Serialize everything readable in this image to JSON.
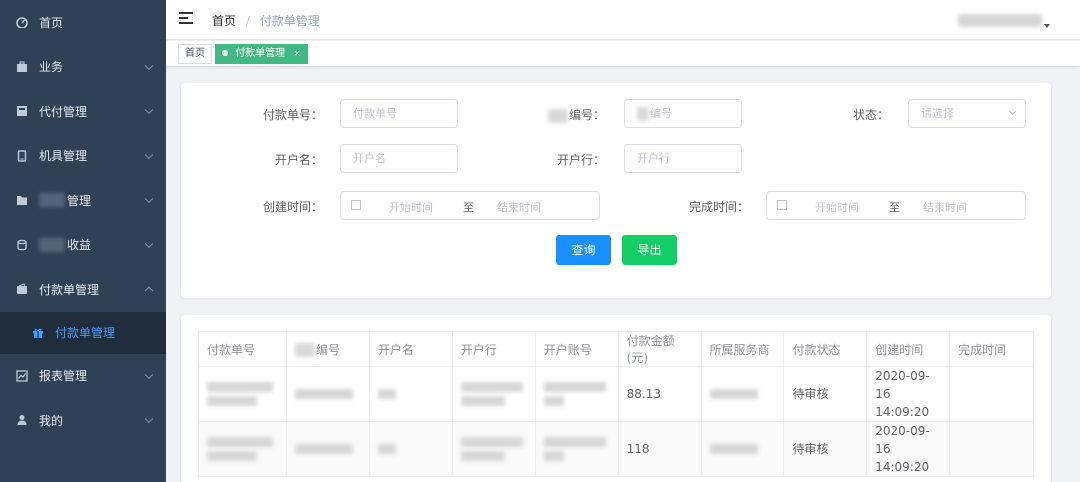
{
  "sidebar": {
    "items": [
      {
        "label": "首页",
        "icon": "dashboard-icon",
        "has_arrow": false
      },
      {
        "label": "业务",
        "icon": "briefcase-icon",
        "has_arrow": true
      },
      {
        "label": "代付管理",
        "icon": "payment-icon",
        "has_arrow": true
      },
      {
        "label": "机具管理",
        "icon": "device-icon",
        "has_arrow": true
      },
      {
        "label": "管理",
        "icon": "folder-icon",
        "has_arrow": true,
        "blurred_prefix": true
      },
      {
        "label": "收益",
        "icon": "coins-icon",
        "has_arrow": true,
        "blurred_prefix": true
      },
      {
        "label": "付款单管理",
        "icon": "wallet-icon",
        "has_arrow": true,
        "expanded": true
      }
    ],
    "active_sub": {
      "label": "付款单管理",
      "icon": "gift-icon"
    },
    "items_after": [
      {
        "label": "报表管理",
        "icon": "chart-icon",
        "has_arrow": true
      },
      {
        "label": "我的",
        "icon": "user-icon",
        "has_arrow": true
      }
    ]
  },
  "header": {
    "breadcrumb": [
      "首页",
      "付款单管理"
    ],
    "separator": "/"
  },
  "tags": [
    {
      "label": "首页",
      "active": false
    },
    {
      "label": "付款单管理",
      "active": true,
      "close": "×"
    }
  ],
  "search": {
    "fields": {
      "order_no": {
        "label": "付款单号：",
        "placeholder": "付款单号"
      },
      "code": {
        "label": "编号：",
        "placeholder": "编号"
      },
      "status": {
        "label": "状态：",
        "placeholder": "请选择"
      },
      "account_name": {
        "label": "开户名：",
        "placeholder": "开户名"
      },
      "bank": {
        "label": "开户行：",
        "placeholder": "开户行"
      },
      "created": {
        "label": "创建时间：",
        "start": "开始时间",
        "to": "至",
        "end": "结束时间"
      },
      "completed": {
        "label": "完成时间：",
        "start": "开始时间",
        "to": "至",
        "end": "结束时间"
      }
    },
    "buttons": {
      "query": "查询",
      "export": "导出"
    }
  },
  "table": {
    "columns": [
      "付款单号",
      "编号",
      "开户名",
      "开户行",
      "开户账号",
      "付款金额(元)",
      "所属服务商",
      "付款状态",
      "创建时间",
      "完成时间"
    ],
    "rows": [
      {
        "amount": "88.13",
        "status": "待审核",
        "created_date": "2020-09-16",
        "created_time": "14:09:20"
      },
      {
        "amount": "118",
        "status": "待审核",
        "created_date": "2020-09-16",
        "created_time": "14:09:20"
      }
    ]
  },
  "colors": {
    "sidebar_bg": "#304156",
    "submenu_bg": "#1f2d3d",
    "accent_blue": "#409eff",
    "tag_green": "#42b983",
    "primary_btn": "#1890ff",
    "success_btn": "#13ce66"
  }
}
